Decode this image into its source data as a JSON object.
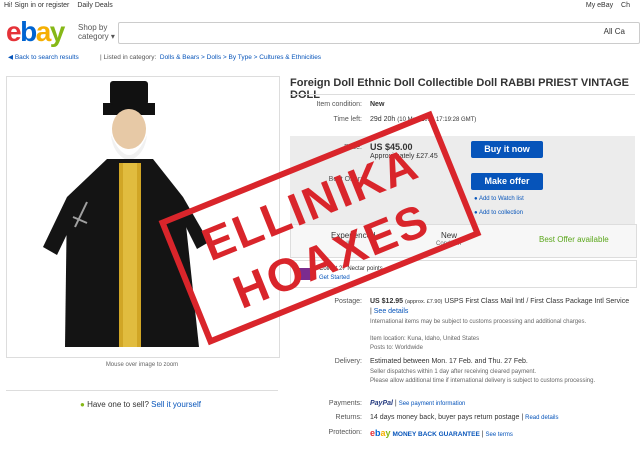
{
  "topbar": {
    "signin": "Hi! Sign in or register",
    "deals": "Daily Deals",
    "myebay": "My eBay",
    "cart": "Ch"
  },
  "header": {
    "logo": {
      "e": "e",
      "b": "b",
      "a": "a",
      "y": "y"
    },
    "shopby": "Shop by",
    "category": "category",
    "search_cat": "All Ca"
  },
  "crumbs": {
    "back": "Back to search results",
    "listed": "| Listed in category:",
    "path": "Dolls & Bears  >  Dolls  >  By Type  >  Cultures & Ethnicities"
  },
  "image": {
    "caption": "Mouse over image to zoom"
  },
  "sell": {
    "q": "Have one to sell?",
    "link": "Sell it yourself"
  },
  "item": {
    "title": "Foreign Doll Ethnic Doll Collectible Doll RABBI PRIEST VINTAGE DOLL",
    "condition_label": "Item condition:",
    "condition": "New",
    "timeleft_label": "Time left:",
    "timeleft": "29d 20h",
    "timeleft_date": "(10 Mar, 2014   17:19:28 GMT)",
    "price_label": "Price:",
    "price": "US $45.00",
    "approx": "Approximately £27.45",
    "buy_btn": "Buy it now",
    "offer_label": "Best Offer:",
    "offer_btn": "Make offer",
    "watch": "Add to Watch list",
    "collection": "Add to collection",
    "seller_exp": "Experienced",
    "seller": "Seller",
    "cond_new": "New",
    "cond_lbl": "Condition",
    "best_offer": "Best Offer available",
    "collect": "Collect 27 Nectar points",
    "get_started": "Get Started",
    "postage_label": "Postage:",
    "postage": "US $12.95",
    "postage_approx": "(approx. £7.90)",
    "postage_service": "USPS First Class Mail Intl / First Class Package Intl Service",
    "see_details": "See details",
    "intl_note": "International items may be subject to customs processing and additional charges.",
    "location": "Item location: Kuna, Idaho, United States",
    "posts_to": "Posts to: Worldwide",
    "delivery_label": "Delivery:",
    "delivery": "Estimated between Mon. 17 Feb. and Thu. 27 Feb.",
    "dispatch": "Seller dispatches within 1 day after receiving cleared payment.",
    "allow": "Please allow additional time if international delivery is subject to customs processing.",
    "payments_label": "Payments:",
    "paypal": "PayPal",
    "see_payment": "See payment information",
    "returns_label": "Returns:",
    "returns": "14 days money back, buyer pays return postage",
    "read_details": "Read details",
    "protection_label": "Protection:",
    "mbg": "MONEY BACK GUARANTEE",
    "see_terms": "See terms"
  },
  "stamp": {
    "line1": "ELLINIKA",
    "line2": "HOAXES"
  },
  "colors": {
    "stamp": "#d9252b",
    "accent": "#0654ba",
    "best_offer": "#5ba71b"
  }
}
